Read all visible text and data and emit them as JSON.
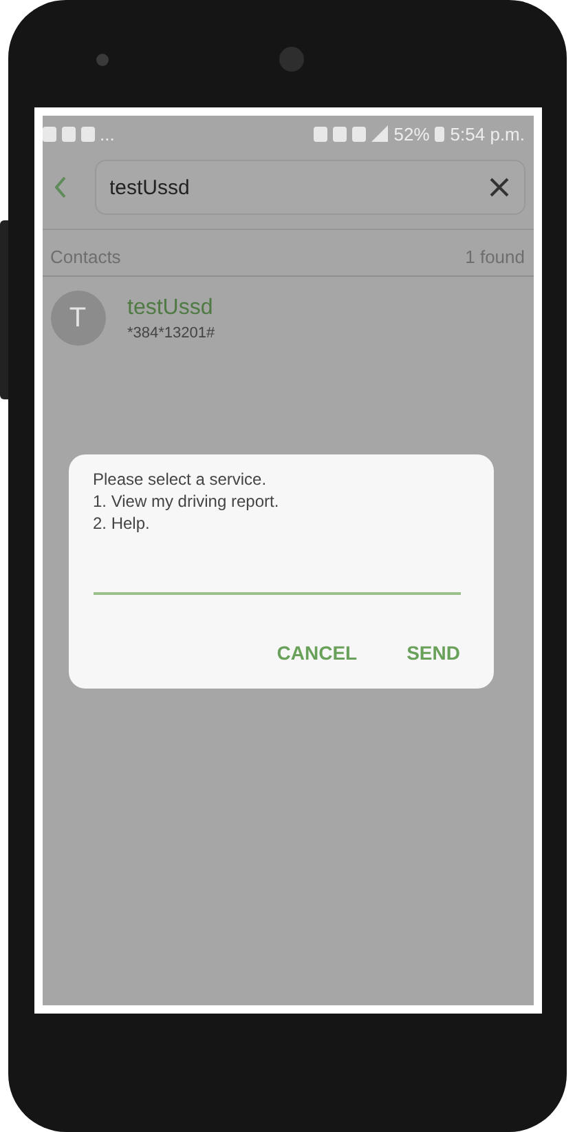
{
  "status_bar": {
    "overflow": "...",
    "battery": "52%",
    "time": "5:54 p.m."
  },
  "search": {
    "value": "testUssd"
  },
  "results": {
    "section": "Contacts",
    "count": "1 found"
  },
  "contacts": [
    {
      "initial": "T",
      "name": "testUssd",
      "number": "*384*13201#"
    }
  ],
  "dialog": {
    "message": "Please select a service.\n1. View my driving report.\n2. Help.",
    "buttons": [
      "CANCEL",
      "SEND"
    ]
  }
}
